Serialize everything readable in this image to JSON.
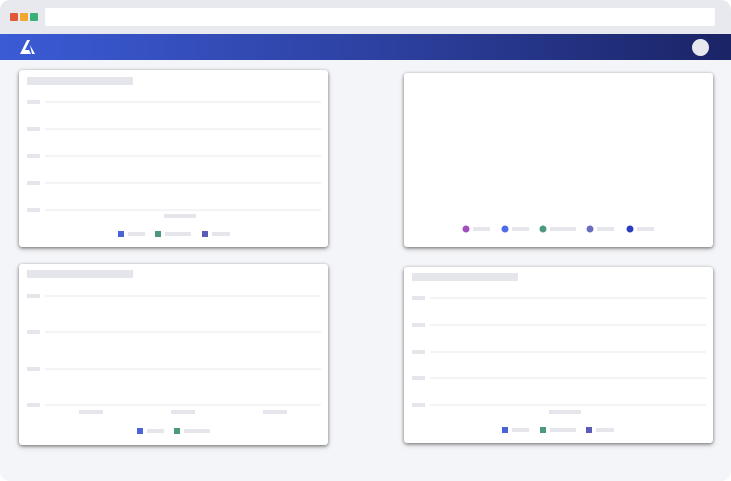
{
  "window": {
    "controls": [
      {
        "name": "close",
        "color": "#e05a3a"
      },
      {
        "name": "minimize",
        "color": "#f0a830"
      },
      {
        "name": "maximize",
        "color": "#3aaf78"
      }
    ],
    "address_bar": {
      "value": ""
    }
  },
  "app_bar": {
    "logo_icon": "a-logo-icon",
    "avatar_icon": "user-avatar-icon",
    "gradient": [
      "#3b5bd6",
      "#1a2466"
    ]
  },
  "colors": {
    "blue": "#4a64d8",
    "green": "#4c9a7c",
    "indigo": "#5a5cb8",
    "purple": "#a24fc0",
    "royal": "#4f6be8",
    "teal": "#4a9a80",
    "violet": "#6a6cc0",
    "navy": "#2a3ec0"
  },
  "widgets": [
    {
      "name": "chart-widget-top-left",
      "title": "",
      "legend": [
        {
          "color": "#4a64d8",
          "label": ""
        },
        {
          "color": "#4c9a7c",
          "label": ""
        },
        {
          "color": "#5a5cb8",
          "label": ""
        }
      ]
    },
    {
      "name": "chart-widget-top-right",
      "title": "",
      "legend": [
        {
          "color": "#a24fc0",
          "label": ""
        },
        {
          "color": "#4f6be8",
          "label": ""
        },
        {
          "color": "#4a9a80",
          "label": ""
        },
        {
          "color": "#6a6cc0",
          "label": ""
        },
        {
          "color": "#2a3ec0",
          "label": ""
        }
      ]
    },
    {
      "name": "chart-widget-bottom-left",
      "title": "",
      "legend": [
        {
          "color": "#4a64d8",
          "label": ""
        },
        {
          "color": "#4c9a7c",
          "label": ""
        }
      ]
    },
    {
      "name": "chart-widget-bottom-right",
      "title": "",
      "legend": [
        {
          "color": "#4a64d8",
          "label": ""
        },
        {
          "color": "#4c9a7c",
          "label": ""
        },
        {
          "color": "#5a5cb8",
          "label": ""
        }
      ]
    }
  ]
}
